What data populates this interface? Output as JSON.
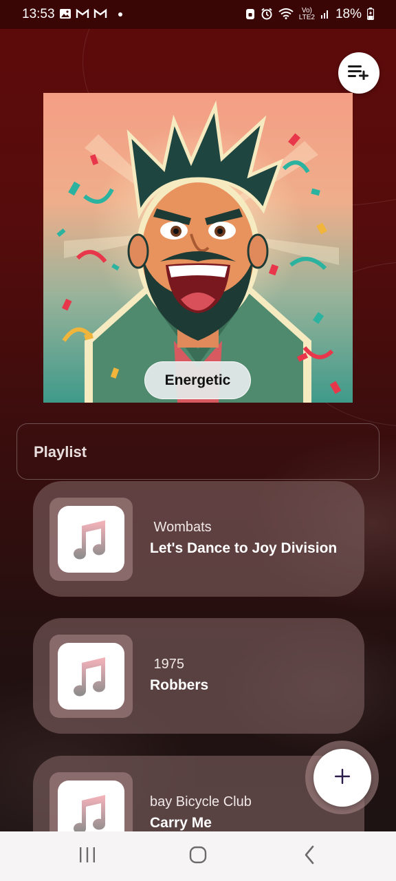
{
  "status_bar": {
    "time": "13:53",
    "battery": "18%",
    "network": "LTE2"
  },
  "header": {
    "queue_button_icon": "playlist-add-icon"
  },
  "now_playing": {
    "mood": "Energetic",
    "cover_icon": "cover-art"
  },
  "playlist": {
    "title": "Playlist",
    "songs": [
      {
        "artist": " Wombats",
        "title": "Let's Dance to Joy Division"
      },
      {
        "artist": " 1975",
        "title": "Robbers"
      },
      {
        "artist": "bay Bicycle Club",
        "title": "Carry Me"
      }
    ]
  },
  "fab": {
    "icon": "plus-icon"
  },
  "colors": {
    "background_top": "#5e0a0a",
    "background_bottom": "#1d1414",
    "card": "#7d5f5f",
    "accent": "#2b1b4a"
  }
}
